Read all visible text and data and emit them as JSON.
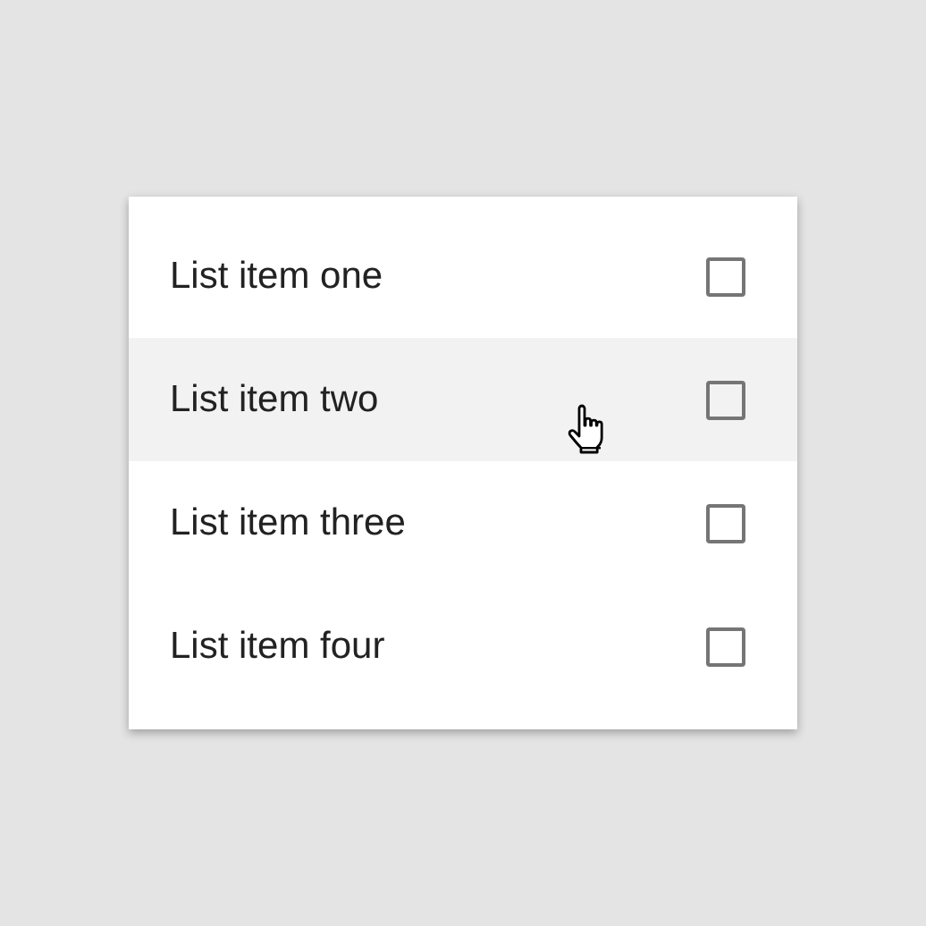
{
  "list": [
    {
      "label": "List item one",
      "checked": false,
      "hovered": false
    },
    {
      "label": "List item two",
      "checked": false,
      "hovered": true
    },
    {
      "label": "List item three",
      "checked": false,
      "hovered": false
    },
    {
      "label": "List item four",
      "checked": false,
      "hovered": false
    }
  ]
}
